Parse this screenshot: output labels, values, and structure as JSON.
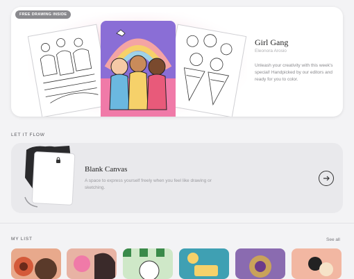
{
  "featured": {
    "badge": "FREE DRAWING INSIDE",
    "title": "Girl Gang",
    "author": "Eleonora Arosio",
    "description": "Unleash your creativity with this week's special! Handpicked by our editors and ready for you to color."
  },
  "let_it_flow": {
    "heading": "LET IT FLOW",
    "card_title": "Blank Canvas",
    "card_description": "A space to express yourself freely when you feel like drawing or sketching.",
    "lock_icon": "lock-icon",
    "arrow_icon": "arrow-right-icon"
  },
  "my_list": {
    "heading": "MY LIST",
    "see_all": "See all",
    "items": [
      {
        "title": "",
        "color": "#e8a98c"
      },
      {
        "title": "",
        "color": "#e8b3a4"
      },
      {
        "title": "",
        "color": "#cfe8c8"
      },
      {
        "title": "",
        "color": "#3fa0b3"
      },
      {
        "title": "",
        "color": "#8a6bb0"
      },
      {
        "title": "",
        "color": "#f2b7a2"
      }
    ]
  }
}
